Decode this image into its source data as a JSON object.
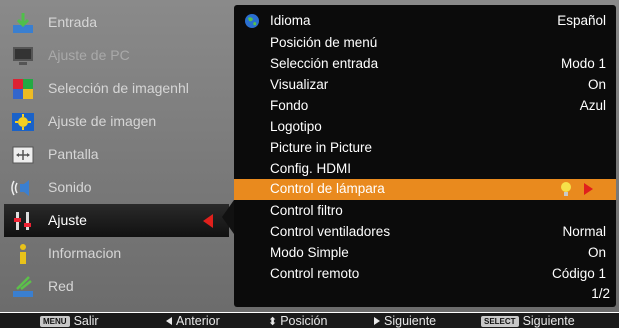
{
  "sidebar": {
    "items": [
      {
        "label": "Entrada",
        "icon": "input-icon",
        "selected": false,
        "dim": false
      },
      {
        "label": "Ajuste de PC",
        "icon": "pc-adjust-icon",
        "selected": false,
        "dim": true
      },
      {
        "label": "Selección de imagenhl",
        "icon": "image-select-icon",
        "selected": false,
        "dim": false
      },
      {
        "label": "Ajuste de imagen",
        "icon": "image-adjust-icon",
        "selected": false,
        "dim": false
      },
      {
        "label": "Pantalla",
        "icon": "screen-icon",
        "selected": false,
        "dim": false
      },
      {
        "label": "Sonido",
        "icon": "sound-icon",
        "selected": false,
        "dim": false
      },
      {
        "label": "Ajuste",
        "icon": "setting-icon",
        "selected": true,
        "dim": false
      },
      {
        "label": "Informacion",
        "icon": "information-icon",
        "selected": false,
        "dim": false
      },
      {
        "label": "Red",
        "icon": "network-icon",
        "selected": false,
        "dim": false
      }
    ]
  },
  "panel": {
    "rows": [
      {
        "label": "Idioma",
        "value": "Español",
        "icon": "globe-icon"
      },
      {
        "label": "Posición de menú",
        "value": ""
      },
      {
        "label": "Selección entrada",
        "value": "Modo 1"
      },
      {
        "label": "Visualizar",
        "value": "On"
      },
      {
        "label": "Fondo",
        "value": "Azul"
      },
      {
        "label": "Logotipo",
        "value": ""
      },
      {
        "label": "Picture in Picture",
        "value": ""
      },
      {
        "label": "Config. HDMI",
        "value": ""
      },
      {
        "label": "Control de lámpara",
        "value": "",
        "selected": true,
        "icon": "lamp-bulb-icon"
      },
      {
        "label": "Control filtro",
        "value": ""
      },
      {
        "label": "Control ventiladores",
        "value": "Normal"
      },
      {
        "label": "Modo Simple",
        "value": "On"
      },
      {
        "label": "Control remoto",
        "value": "Código 1"
      }
    ],
    "page": "1/2"
  },
  "footer": {
    "menu_key": "MENU",
    "menu_label": "Salir",
    "prev_label": "Anterior",
    "pos_label": "Posición",
    "next_label": "Siguiente",
    "select_key": "SELECT",
    "select_label": "Siguiente"
  },
  "colors": {
    "highlight": "#e98a1e",
    "arrow": "#e0201c",
    "panel_bg": "#0b0b0b",
    "osd_bg": "#7b7b7b"
  }
}
